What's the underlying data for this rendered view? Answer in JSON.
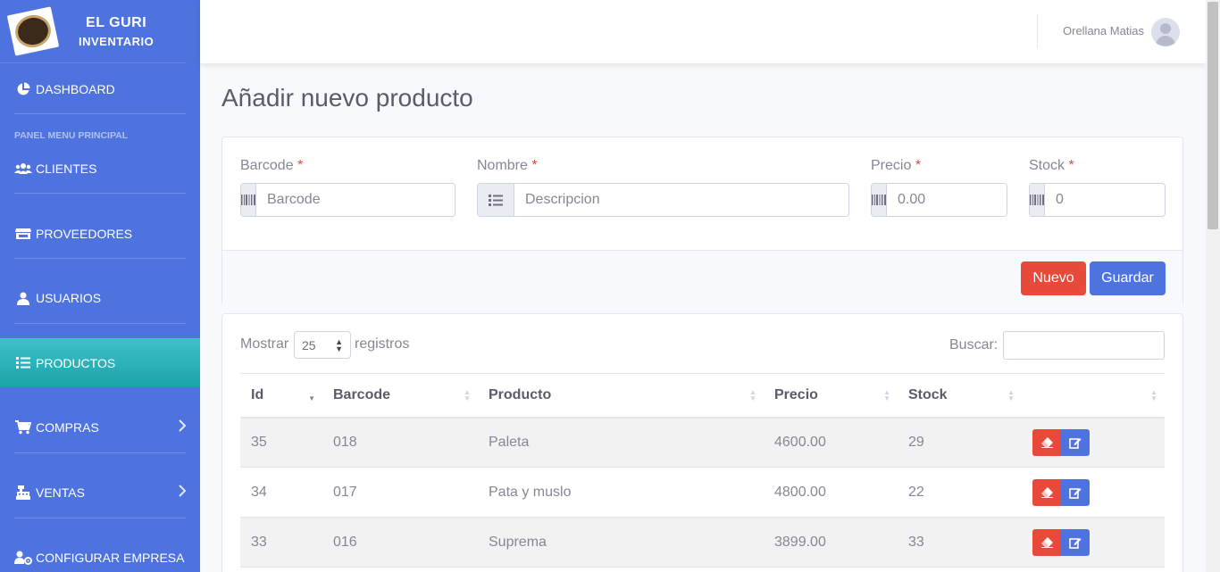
{
  "brand": {
    "line1": "EL GURI",
    "line2": "INVENTARIO"
  },
  "sidebar": {
    "heading": "PANEL MENU PRINCIPAL",
    "items": [
      {
        "label": "DASHBOARD",
        "icon": "chart-pie-icon"
      },
      {
        "label": "CLIENTES",
        "icon": "users-icon"
      },
      {
        "label": "PROVEEDORES",
        "icon": "store-icon"
      },
      {
        "label": "USUARIOS",
        "icon": "user-icon"
      },
      {
        "label": "PRODUCTOS",
        "icon": "list-icon",
        "active": true
      },
      {
        "label": "COMPRAS",
        "icon": "cart-icon",
        "has_submenu": true
      },
      {
        "label": "VENTAS",
        "icon": "cash-register-icon",
        "has_submenu": true
      },
      {
        "label": "CONFIGURAR EMPRESA",
        "icon": "users-cog-icon"
      }
    ]
  },
  "topbar": {
    "user_name": "Orellana Matias"
  },
  "page": {
    "title": "Añadir nuevo producto"
  },
  "form": {
    "required_mark": "*",
    "barcode": {
      "label": "Barcode",
      "placeholder": "Barcode"
    },
    "nombre": {
      "label": "Nombre",
      "placeholder": "Descripcion"
    },
    "precio": {
      "label": "Precio",
      "placeholder": "0.00"
    },
    "stock": {
      "label": "Stock",
      "placeholder": "0"
    },
    "btn_nuevo": "Nuevo",
    "btn_guardar": "Guardar"
  },
  "table": {
    "show_label": "Mostrar",
    "show_value": "25",
    "records_label": "registros",
    "search_label": "Buscar:",
    "columns": [
      "Id",
      "Barcode",
      "Producto",
      "Precio",
      "Stock",
      ""
    ],
    "rows": [
      {
        "id": "35",
        "barcode": "018",
        "producto": "Paleta",
        "precio": "4600.00",
        "stock": "29"
      },
      {
        "id": "34",
        "barcode": "017",
        "producto": "Pata y muslo",
        "precio": "4800.00",
        "stock": "22"
      },
      {
        "id": "33",
        "barcode": "016",
        "producto": "Suprema",
        "precio": "3899.00",
        "stock": "33"
      }
    ]
  },
  "colors": {
    "primary": "#4e73df",
    "danger": "#e74a3b",
    "active": "#36b9cc"
  }
}
